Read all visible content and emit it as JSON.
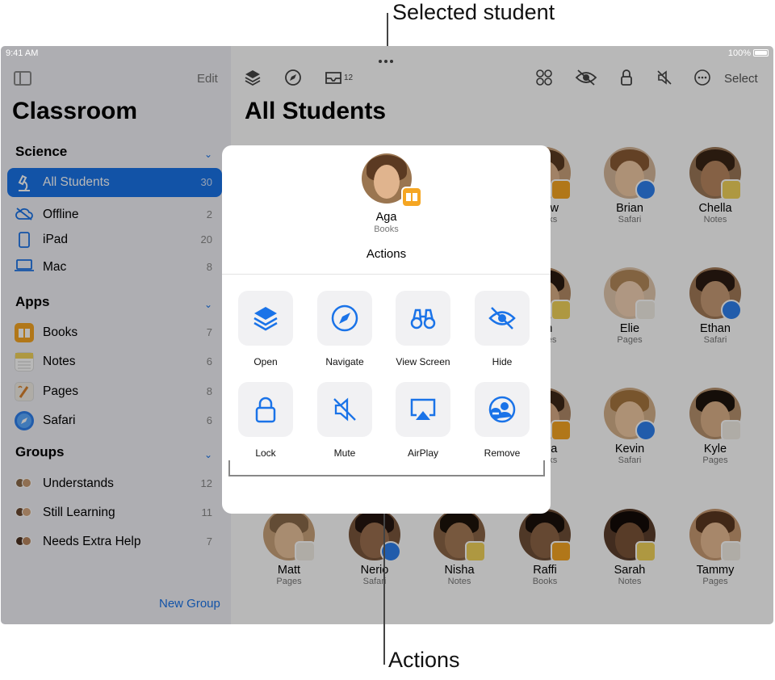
{
  "callouts": {
    "top": "Selected student",
    "bottom": "Actions"
  },
  "status": {
    "time": "9:41 AM",
    "battery": "100%"
  },
  "sidebar": {
    "edit": "Edit",
    "title": "Classroom",
    "sections": {
      "science": "Science",
      "apps": "Apps",
      "groups": "Groups"
    },
    "science_items": [
      {
        "label": "All Students",
        "count": "30"
      },
      {
        "label": "Offline",
        "count": "2"
      },
      {
        "label": "iPad",
        "count": "20"
      },
      {
        "label": "Mac",
        "count": "8"
      }
    ],
    "app_items": [
      {
        "label": "Books",
        "count": "7"
      },
      {
        "label": "Notes",
        "count": "6"
      },
      {
        "label": "Pages",
        "count": "8"
      },
      {
        "label": "Safari",
        "count": "6"
      }
    ],
    "group_items": [
      {
        "label": "Understands",
        "count": "12"
      },
      {
        "label": "Still Learning",
        "count": "11"
      },
      {
        "label": "Needs Extra Help",
        "count": "7"
      }
    ],
    "new_group": "New Group"
  },
  "toolbar": {
    "inbox_count": "12",
    "select": "Select"
  },
  "main": {
    "title": "All Students",
    "students": [
      {
        "name": "Drew",
        "app": "Books"
      },
      {
        "name": "Brian",
        "app": "Safari"
      },
      {
        "name": "Chella",
        "app": "Notes"
      },
      {
        "name": "Jin",
        "app": "Notes"
      },
      {
        "name": "Elie",
        "app": "Pages"
      },
      {
        "name": "Ethan",
        "app": "Safari"
      },
      {
        "name": "Gina",
        "app": "Books"
      },
      {
        "name": "Kevin",
        "app": "Safari"
      },
      {
        "name": "Kyle",
        "app": "Pages"
      },
      {
        "name": "Matt",
        "app": "Pages"
      },
      {
        "name": "Nerio",
        "app": "Safari"
      },
      {
        "name": "Nisha",
        "app": "Notes"
      },
      {
        "name": "Raffi",
        "app": "Books"
      },
      {
        "name": "Sarah",
        "app": "Notes"
      },
      {
        "name": "Tammy",
        "app": "Pages"
      }
    ]
  },
  "popover": {
    "student_name": "Aga",
    "student_app": "Books",
    "heading": "Actions",
    "actions": [
      "Open",
      "Navigate",
      "View Screen",
      "Hide",
      "Lock",
      "Mute",
      "AirPlay",
      "Remove"
    ]
  },
  "colors": {
    "accent": "#1a73e8",
    "books": "#f5a623",
    "notes": "#f2d35a",
    "pages": "#f3efe6",
    "safari": "#2f80ed"
  }
}
